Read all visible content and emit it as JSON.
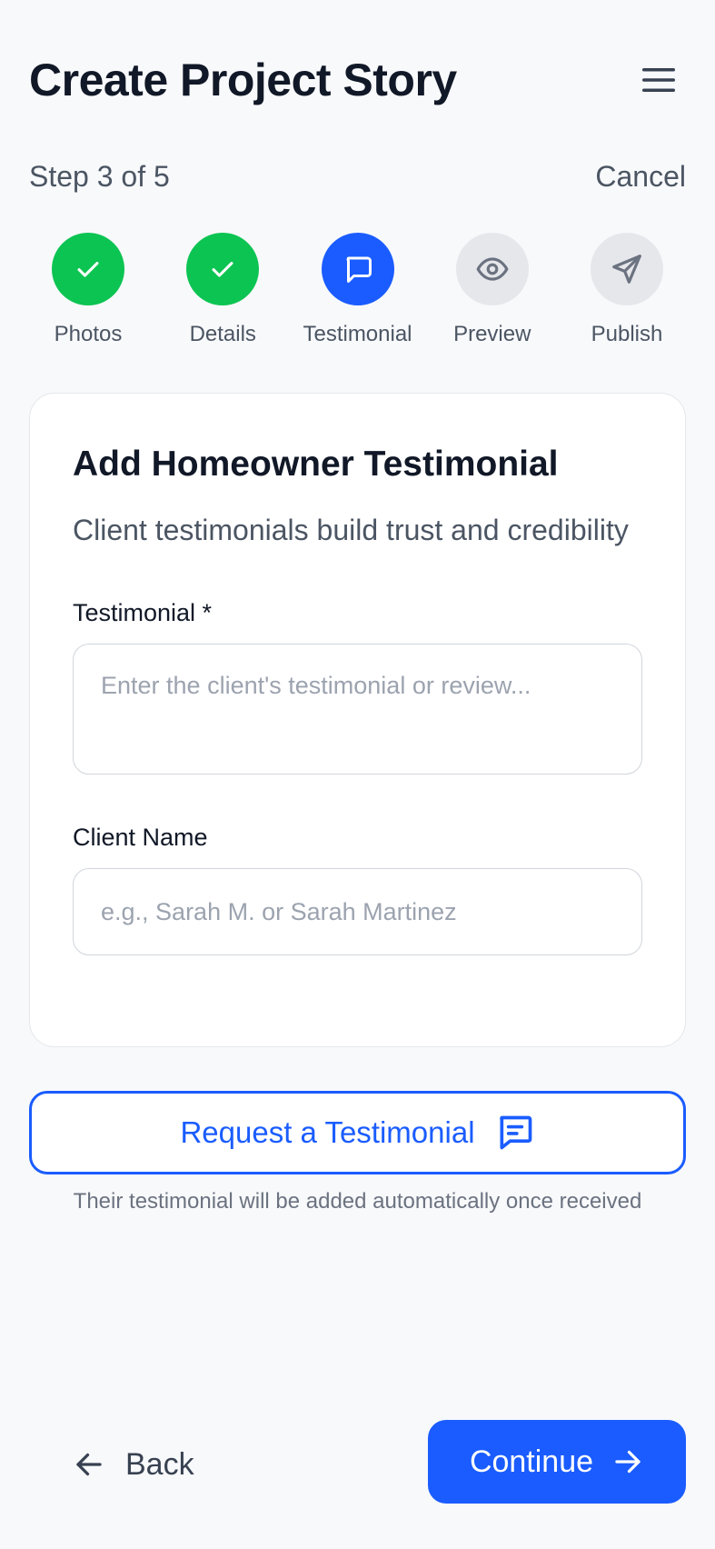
{
  "header": {
    "title": "Create Project Story",
    "menu_icon": "hamburger-menu-icon"
  },
  "progress": {
    "step_text": "Step 3 of 5",
    "current_step": 3,
    "total_steps": 5,
    "cancel_label": "Cancel"
  },
  "stepper": {
    "steps": [
      {
        "label": "Photos",
        "state": "done",
        "icon": "check-icon"
      },
      {
        "label": "Details",
        "state": "done",
        "icon": "check-icon"
      },
      {
        "label": "Testimonial",
        "state": "active",
        "icon": "message-square-icon"
      },
      {
        "label": "Preview",
        "state": "todo",
        "icon": "eye-icon"
      },
      {
        "label": "Publish",
        "state": "todo",
        "icon": "send-icon"
      }
    ]
  },
  "card": {
    "title": "Add Homeowner Testimonial",
    "subtitle": "Client testimonials build trust and credibility",
    "testimonial_label": "Testimonial *",
    "testimonial_placeholder": "Enter the client's testimonial or review...",
    "testimonial_value": "",
    "client_name_label": "Client Name",
    "client_name_placeholder": "e.g., Sarah M. or Sarah Martinez",
    "client_name_value": ""
  },
  "request": {
    "label": "Request a Testimonial",
    "icon": "message-lines-icon",
    "helper_text": "Their testimonial will be added automatically once received"
  },
  "footer": {
    "back_label": "Back",
    "back_icon": "arrow-left-icon",
    "continue_label": "Continue",
    "continue_icon": "arrow-right-icon"
  },
  "colors": {
    "primary": "#1a5cff",
    "success": "#0cc452",
    "inactive": "#e5e7eb",
    "background": "#f8f9fb",
    "text_dark": "#111827",
    "text_muted": "#4b5563"
  }
}
